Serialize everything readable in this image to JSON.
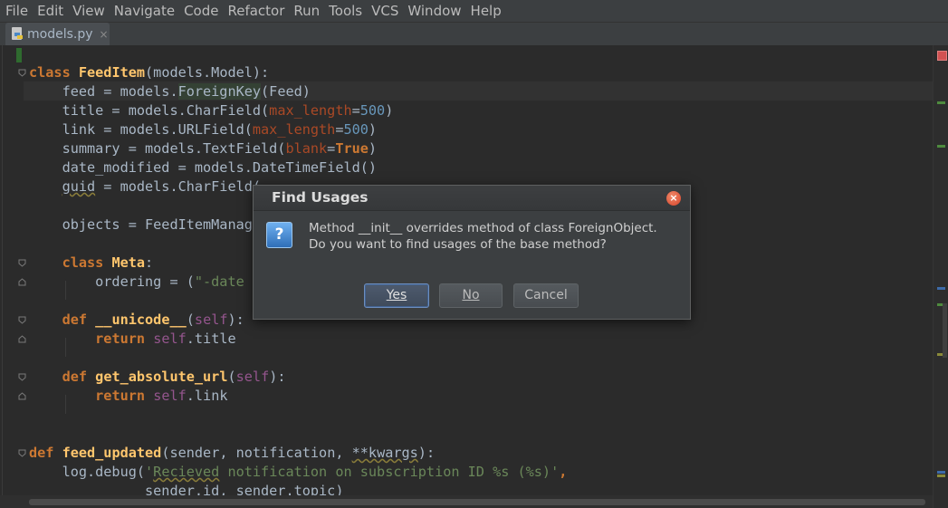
{
  "menu": [
    "File",
    "Edit",
    "View",
    "Navigate",
    "Code",
    "Refactor",
    "Run",
    "Tools",
    "VCS",
    "Window",
    "Help"
  ],
  "tab": {
    "label": "models.py",
    "close": "×"
  },
  "code": {
    "l1_kw": "class",
    "l1_name": "FeedItem",
    "l1_rest": "(models.Model):",
    "l2_a": "    feed = models.",
    "l2_hl": "ForeignKey",
    "l2_b": "(Feed)",
    "l3_a": "    title = models.CharField(",
    "l3_p": "max_length",
    "l3_eq": "=",
    "l3_n": "500",
    "l3_c": ")",
    "l4_a": "    link = models.URLField(",
    "l4_p": "max_length",
    "l4_eq": "=",
    "l4_n": "500",
    "l4_c": ")",
    "l5_a": "    summary = models.TextField(",
    "l5_p": "blank",
    "l5_eq": "=",
    "l5_v": "True",
    "l5_c": ")",
    "l6": "    date_modified = models.DateTimeField()",
    "l7_sp": "    ",
    "l7_sq": "guid",
    "l7_rest": " = models.CharField(",
    "l8": "    objects = FeedItemManager()",
    "l9_sp": "    ",
    "l9_kw": "class",
    "l9_sp2": " ",
    "l9_name": "Meta",
    "l9_rest": ":",
    "l10_a": "        ordering = (",
    "l10_s": "\"-date",
    "l11_sp": "    ",
    "l11_kw": "def",
    "l11_sp2": " ",
    "l11_name": "__unicode__",
    "l11_o": "(",
    "l11_self": "self",
    "l11_c": "):",
    "l12_sp": "        ",
    "l12_kw": "return",
    "l12_sp2": " ",
    "l12_self": "self",
    "l12_rest": ".title",
    "l13_sp": "    ",
    "l13_kw": "def",
    "l13_sp2": " ",
    "l13_name": "get_absolute_url",
    "l13_o": "(",
    "l13_self": "self",
    "l13_c": "):",
    "l14_sp": "        ",
    "l14_kw": "return",
    "l14_sp2": " ",
    "l14_self": "self",
    "l14_rest": ".link",
    "l15_kw": "def",
    "l15_sp": " ",
    "l15_name": "feed_updated",
    "l15_a": "(sender, notification, ",
    "l15_sq": "**kwargs",
    "l15_c": "):",
    "l16_a": "    log.debug(",
    "l16_s1": "'",
    "l16_sq": "Recieved",
    "l16_s2": " notification on subscription ID %s (%s)'",
    "l16_c": ",",
    "l17": "              sender.id, sender.topic)"
  },
  "dialog": {
    "title": "Find Usages",
    "close": "×",
    "icon": "?",
    "line1": "Method __init__ overrides method of class ForeignObject.",
    "line2": "Do you want to find usages of the base method?",
    "yes": "Yes",
    "no": "No",
    "cancel": "Cancel"
  },
  "colors": {
    "keyword": "#cc7832",
    "function": "#ffc66d",
    "self": "#94558d",
    "param": "#aa4926",
    "number": "#6897bb",
    "string": "#6a8759"
  }
}
